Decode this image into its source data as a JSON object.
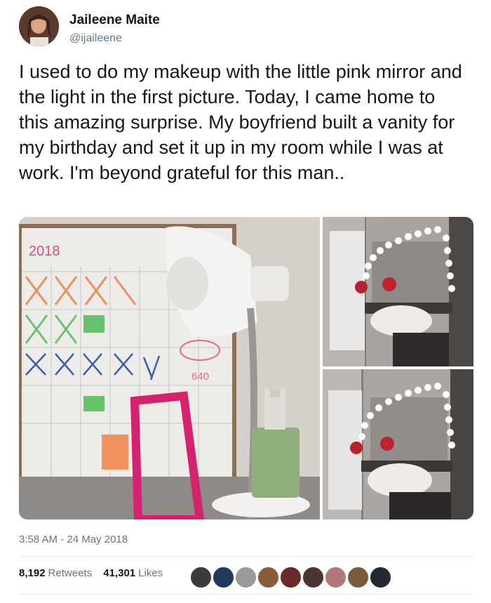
{
  "author": {
    "name": "Jaileene Maite",
    "handle": "@ijaileene"
  },
  "tweet": {
    "text": "I used to do my makeup with the little pink mirror and the light in the first picture. Today, I came home to this amazing surprise. My boyfriend built a vanity for my birthday and set it up in my room while I was at work. I'm beyond grateful for this man.."
  },
  "media": {
    "photo1": {
      "calendar_year": "2018",
      "calendar_amount": "640"
    }
  },
  "meta": {
    "timestamp": "3:58 AM - 24 May 2018"
  },
  "stats": {
    "retweets_count": "8,192",
    "retweets_label": "Retweets",
    "likes_count": "41,301",
    "likes_label": "Likes"
  },
  "likers": [
    "liker-avatar",
    "liker-avatar",
    "liker-avatar",
    "liker-avatar",
    "liker-avatar",
    "liker-avatar",
    "liker-avatar",
    "liker-avatar",
    "liker-avatar"
  ],
  "colors": {
    "text": "#14171a",
    "secondary": "#657786",
    "divider": "#e6ecf0"
  }
}
